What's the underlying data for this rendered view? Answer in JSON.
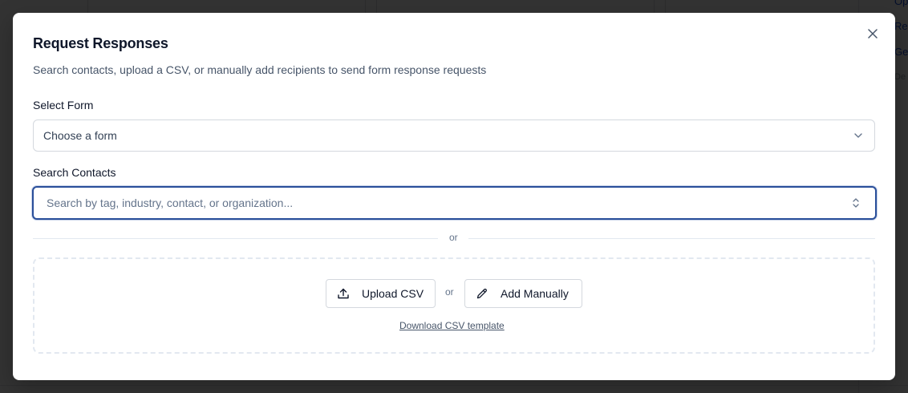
{
  "modal": {
    "title": "Request Responses",
    "subtitle": "Search contacts, upload a CSV, or manually add recipients to send form response requests",
    "close_icon": "close-icon"
  },
  "select_form": {
    "label": "Select Form",
    "value": "Choose a form",
    "icon": "chevron-down-icon"
  },
  "search_contacts": {
    "label": "Search Contacts",
    "placeholder": "Search by tag, industry, contact, or organization...",
    "icon": "chevrons-up-down-icon"
  },
  "divider": {
    "text": "or"
  },
  "dropzone": {
    "upload_label": "Upload CSV",
    "upload_icon": "upload-icon",
    "or_text": "or",
    "manual_label": "Add Manually",
    "manual_icon": "pencil-icon",
    "template_link": "Download CSV template"
  },
  "background": {
    "right_items": [
      "Op",
      "Re",
      "Ge",
      "De"
    ]
  },
  "colors": {
    "focus_ring": "#2a4f9a",
    "overlay": "rgba(0,0,0,0.8)",
    "text_primary": "#0f172a",
    "text_muted": "#64748b"
  }
}
